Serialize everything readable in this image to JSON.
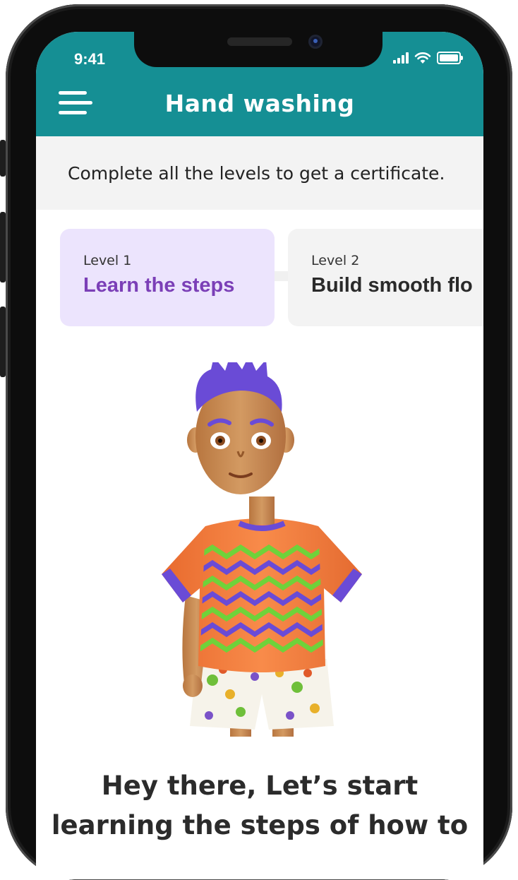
{
  "status_bar": {
    "time": "9:41"
  },
  "header": {
    "title": "Hand washing",
    "menu_icon": "hamburger-menu-icon"
  },
  "info": {
    "text": "Complete all the levels to get a certificate."
  },
  "levels": [
    {
      "number": "Level 1",
      "name": "Learn the steps",
      "state": "active"
    },
    {
      "number": "Level 2",
      "name": "Build smooth flo",
      "state": "locked"
    }
  ],
  "message": {
    "line1": "Hey there, Let’s start",
    "line2": "learning the steps of how to"
  },
  "colors": {
    "header_bg": "#158f94",
    "active_card_bg": "#ece4fd",
    "active_text": "#7b3fb7",
    "shirt": "#f07a3a",
    "hair": "#6a4bd6"
  }
}
